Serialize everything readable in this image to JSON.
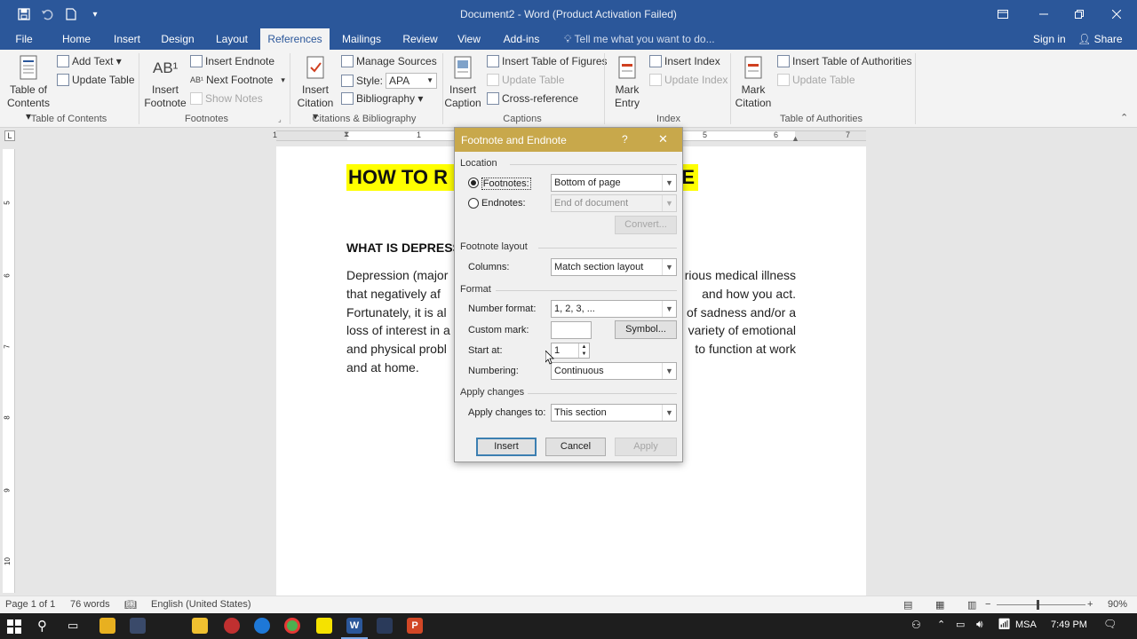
{
  "window": {
    "title": "Document2 - Word (Product Activation Failed)",
    "quick_access": [
      "save-icon",
      "undo-icon",
      "new-document-icon",
      "customize-icon"
    ],
    "controls": [
      "ribbon-display-icon",
      "minimize-icon",
      "restore-icon",
      "close-icon"
    ]
  },
  "tabs": [
    "File",
    "Home",
    "Insert",
    "Design",
    "Layout",
    "References",
    "Mailings",
    "Review",
    "View",
    "Add-ins"
  ],
  "active_tab": "References",
  "tell_me": "Tell me what you want to do...",
  "sign_in": "Sign in",
  "share": "Share",
  "ribbon": {
    "toc": {
      "big1": "Table of",
      "big2": "Contents ▾",
      "add_text": "Add Text ▾",
      "update_table": "Update Table",
      "group": "Table of Contents"
    },
    "footnotes": {
      "big1": "Insert",
      "big2": "Footnote",
      "ab_icon": "AB¹",
      "insert_endnote": "Insert Endnote",
      "next_footnote": "Next Footnote",
      "show_notes": "Show Notes",
      "group": "Footnotes"
    },
    "citations": {
      "big1": "Insert",
      "big2": "Citation ▾",
      "manage_sources": "Manage Sources",
      "style_label": "Style:",
      "style_value": "APA",
      "bibliography": "Bibliography ▾",
      "group": "Citations & Bibliography"
    },
    "captions": {
      "big1": "Insert",
      "big2": "Caption",
      "insert_tof": "Insert Table of Figures",
      "update_table": "Update Table",
      "cross_ref": "Cross-reference",
      "group": "Captions"
    },
    "index": {
      "big1": "Mark",
      "big2": "Entry",
      "insert_index": "Insert Index",
      "update_index": "Update Index",
      "group": "Index"
    },
    "toa": {
      "big1": "Mark",
      "big2": "Citation",
      "insert_toa": "Insert Table of Authorities",
      "update_table": "Update Table",
      "group": "Table of Authorities"
    }
  },
  "ruler": {
    "numbers": [
      "1",
      "1",
      "5",
      "6",
      "7"
    ]
  },
  "vruler": {
    "numbers": [
      "5",
      "6",
      "7",
      "8",
      "9",
      "10"
    ]
  },
  "document": {
    "heading_left": "HOW TO R",
    "heading_right": "TE",
    "subheading": "WHAT IS DEPRESSI",
    "lines": [
      {
        "left": "Depression (major",
        "right": "rious medical illness"
      },
      {
        "left": "that negatively af",
        "right": "and how you act."
      },
      {
        "left": "Fortunately, it is al",
        "right": "of sadness and/or a"
      },
      {
        "left": "loss of interest in a",
        "right": "variety of emotional"
      },
      {
        "left": "and physical probl",
        "right": "to function at work"
      },
      {
        "left": "and at home.",
        "right": ""
      }
    ]
  },
  "dialog": {
    "title": "Footnote and Endnote",
    "help": "?",
    "close": "✕",
    "location_label": "Location",
    "footnotes_label": "Footnotes:",
    "footnotes_value": "Bottom of page",
    "endnotes_label": "Endnotes:",
    "endnotes_value": "End of document",
    "convert": "Convert...",
    "layout_label": "Footnote layout",
    "columns_label": "Columns:",
    "columns_value": "Match section layout",
    "format_label": "Format",
    "number_format_label": "Number format:",
    "number_format_value": "1, 2, 3, ...",
    "custom_mark_label": "Custom mark:",
    "custom_mark_value": "",
    "symbol": "Symbol...",
    "start_at_label": "Start at:",
    "start_at_value": "1",
    "numbering_label": "Numbering:",
    "numbering_value": "Continuous",
    "apply_label": "Apply changes",
    "apply_to_label": "Apply changes to:",
    "apply_to_value": "This section",
    "insert": "Insert",
    "cancel": "Cancel",
    "apply": "Apply"
  },
  "status": {
    "page": "Page 1 of 1",
    "words": "76 words",
    "language": "English (United States)",
    "zoom": "90%",
    "zoom_level_percent": 90
  },
  "taskbar": {
    "language": "MSA",
    "time": "7:49 PM"
  },
  "colors": {
    "accent": "#2b579a",
    "dialog_title": "#c8a84b",
    "highlight": "#ffff00"
  }
}
